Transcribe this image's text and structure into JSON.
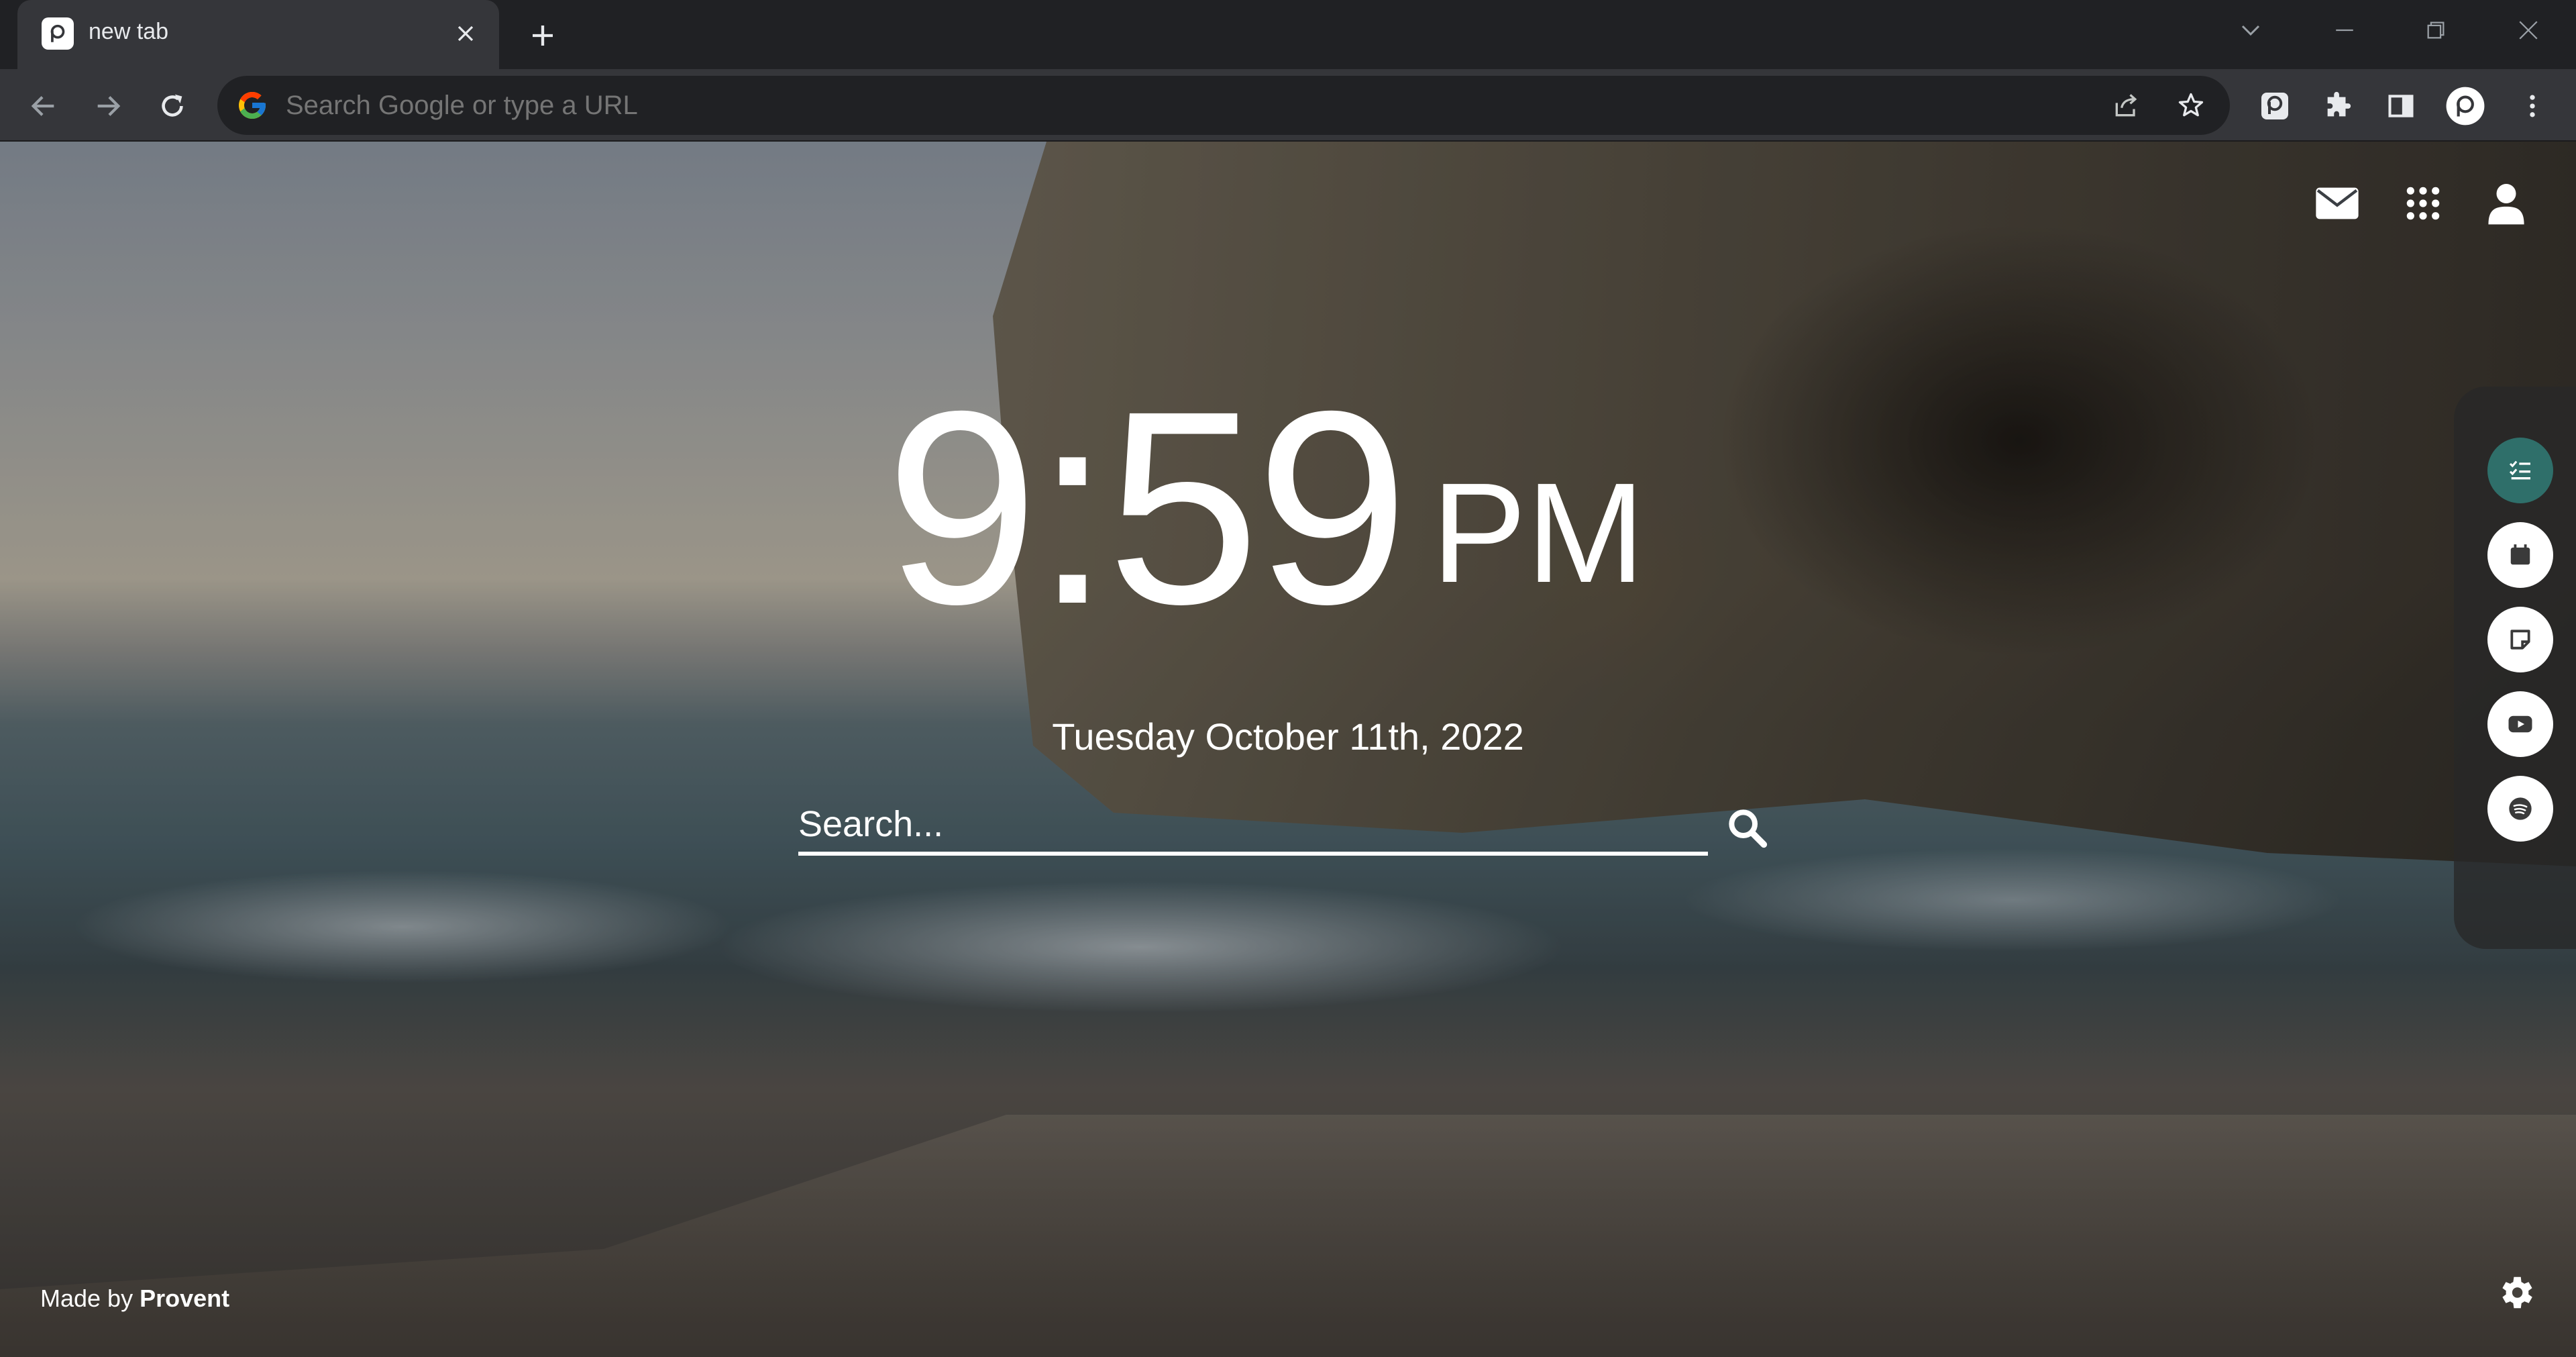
{
  "browser": {
    "tab": {
      "title": "new tab",
      "favicon": "provent-p-icon"
    },
    "omnibox": {
      "placeholder": "Search Google or type a URL"
    },
    "colors": {
      "tabstrip": "#202124",
      "toolbar": "#35363a",
      "omnibox": "#202124",
      "text": "#e8eaed"
    }
  },
  "page": {
    "clock": {
      "time": "9:59",
      "ampm": "PM"
    },
    "date": "Tuesday October 11th, 2022",
    "search": {
      "placeholder": "Search..."
    },
    "top_icons": [
      "mail-icon",
      "apps-grid-icon",
      "account-icon"
    ],
    "side_panel": {
      "items": [
        {
          "name": "todo-list-icon",
          "active": true
        },
        {
          "name": "calendar-icon",
          "active": false
        },
        {
          "name": "sticky-note-icon",
          "active": false
        },
        {
          "name": "youtube-icon",
          "active": false
        },
        {
          "name": "spotify-icon",
          "active": false
        }
      ],
      "active_color": "#2f6f6a"
    },
    "footer": {
      "prefix": "Made by",
      "brand": "Provent"
    }
  }
}
